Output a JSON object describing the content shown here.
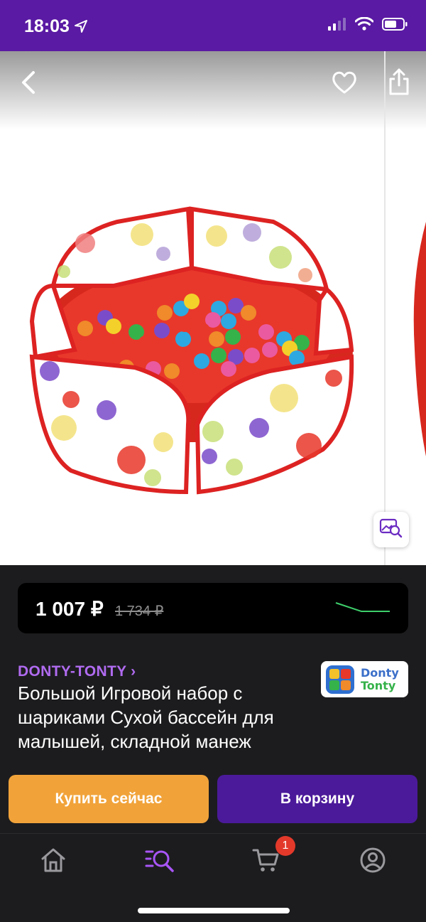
{
  "status_bar": {
    "time": "18:03",
    "icons": [
      "location-arrow-icon",
      "signal-icon",
      "wifi-icon",
      "battery-icon"
    ]
  },
  "hero": {
    "image_description_icon": "product-image",
    "icons": [
      "back-icon",
      "heart-icon",
      "share-icon",
      "visual-search-icon"
    ]
  },
  "price": {
    "current": "1 007 ₽",
    "old": "1 734 ₽",
    "trend_color": "#3ecf6b"
  },
  "brand": {
    "link": "DONTY-TONTY ›",
    "logo_line1": "Donty",
    "logo_line2": "Tonty"
  },
  "product": {
    "title": "Большой Игровой набор с шариками Сухой бассейн для малышей, складной манеж"
  },
  "actions": {
    "buy_now": "Купить сейчас",
    "add_to_cart": "В корзину"
  },
  "tab_bar": {
    "cart_badge": "1",
    "tabs": [
      "home-icon",
      "catalog-search-icon",
      "cart-icon",
      "profile-icon"
    ]
  },
  "colors": {
    "brand_purple": "#5a1aa3",
    "accent_orange": "#f1a33a",
    "cart_button": "#4b1a9a",
    "link_purple": "#b06bf0"
  }
}
